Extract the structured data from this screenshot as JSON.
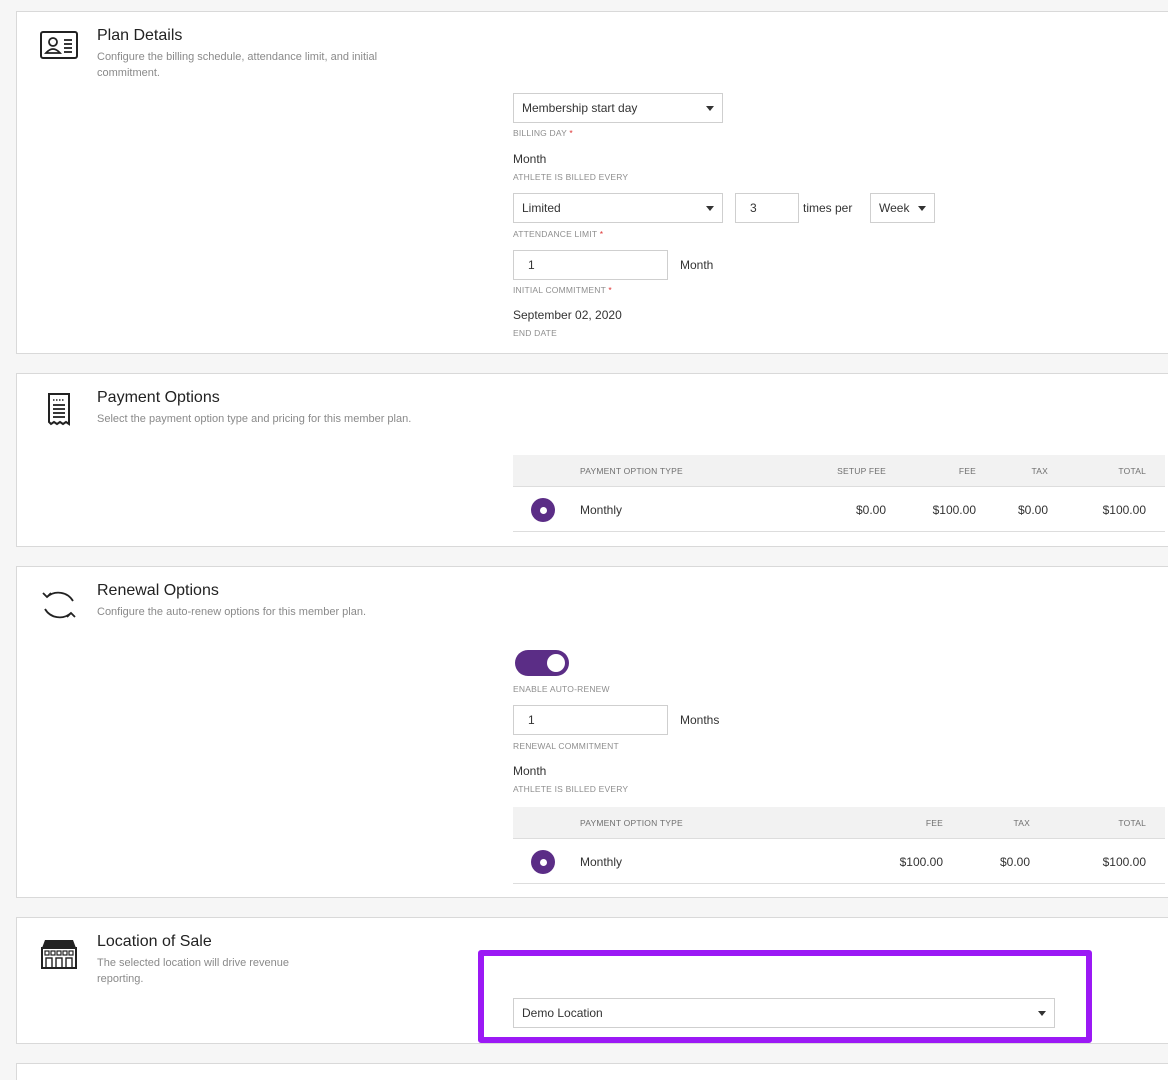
{
  "plan_details": {
    "title": "Plan Details",
    "description": "Configure the billing schedule, attendance limit, and initial commitment.",
    "icon": "id-card-icon",
    "billing_day_value": "Membership start day",
    "billing_day_label": "BILLING DAY",
    "billed_every_value": "Month",
    "billed_every_label": "ATHLETE IS BILLED EVERY",
    "attendance_limit_value": "Limited",
    "attendance_count_value": "3",
    "times_per_text": "times per",
    "attendance_period_value": "Week",
    "attendance_limit_label": "ATTENDANCE LIMIT",
    "initial_commitment_value": "1",
    "initial_commitment_unit": "Month",
    "initial_commitment_label": "INITIAL COMMITMENT",
    "end_date_value": "September 02, 2020",
    "end_date_label": "END DATE",
    "required_mark": "*"
  },
  "payment_options": {
    "title": "Payment Options",
    "description": "Select the payment option type and pricing for this member plan.",
    "icon": "receipt-icon",
    "columns": [
      "PAYMENT OPTION TYPE",
      "SETUP FEE",
      "FEE",
      "TAX",
      "TOTAL"
    ],
    "rows": [
      {
        "type": "Monthly",
        "setup_fee": "$0.00",
        "fee": "$100.00",
        "tax": "$0.00",
        "total": "$100.00",
        "selected": true
      }
    ]
  },
  "renewal_options": {
    "title": "Renewal Options",
    "description": "Configure the auto-renew options for this member plan.",
    "icon": "refresh-cycle-icon",
    "auto_renew_label": "ENABLE AUTO-RENEW",
    "auto_renew_enabled": true,
    "renewal_commitment_value": "1",
    "renewal_commitment_unit": "Months",
    "renewal_commitment_label": "RENEWAL COMMITMENT",
    "billed_every_value": "Month",
    "billed_every_label": "ATHLETE IS BILLED EVERY",
    "columns": [
      "PAYMENT OPTION TYPE",
      "FEE",
      "TAX",
      "TOTAL"
    ],
    "rows": [
      {
        "type": "Monthly",
        "fee": "$100.00",
        "tax": "$0.00",
        "total": "$100.00",
        "selected": true
      }
    ]
  },
  "location_of_sale": {
    "title": "Location of Sale",
    "description": "The selected location will drive revenue reporting.",
    "icon": "storefront-icon",
    "location_value": "Demo Location"
  },
  "colors": {
    "accent": "#5b2d86",
    "highlight": "#9b19f5"
  }
}
